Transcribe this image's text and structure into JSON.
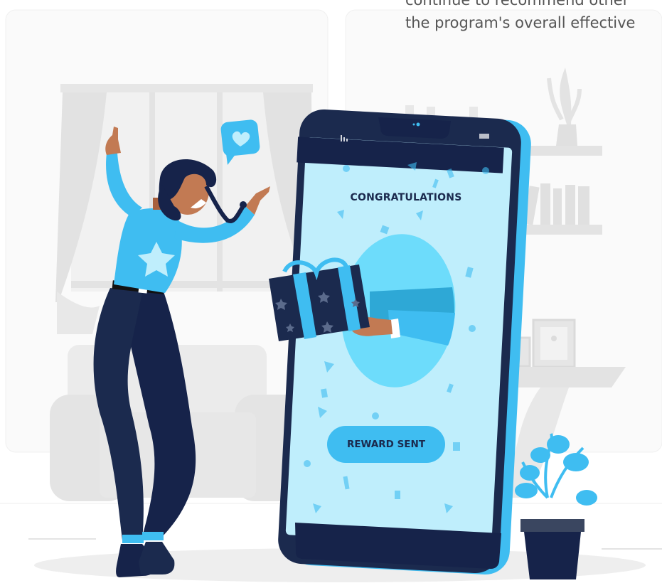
{
  "caption": {
    "line1": "continue to recommend other",
    "line2": "the program's overall effective"
  },
  "phone": {
    "headline": "CONGRATULATIONS",
    "button_label": "REWARD SENT"
  },
  "colors": {
    "accent": "#3fbdf1",
    "accent_light": "#bfeefc",
    "navy": "#16234a",
    "skin": "#c27a53",
    "background_gray": "#ebebeb"
  },
  "icons": [
    "heart-speech-bubble-icon",
    "signal-bars-icon",
    "battery-icon",
    "star-icon",
    "gift-box-icon"
  ]
}
